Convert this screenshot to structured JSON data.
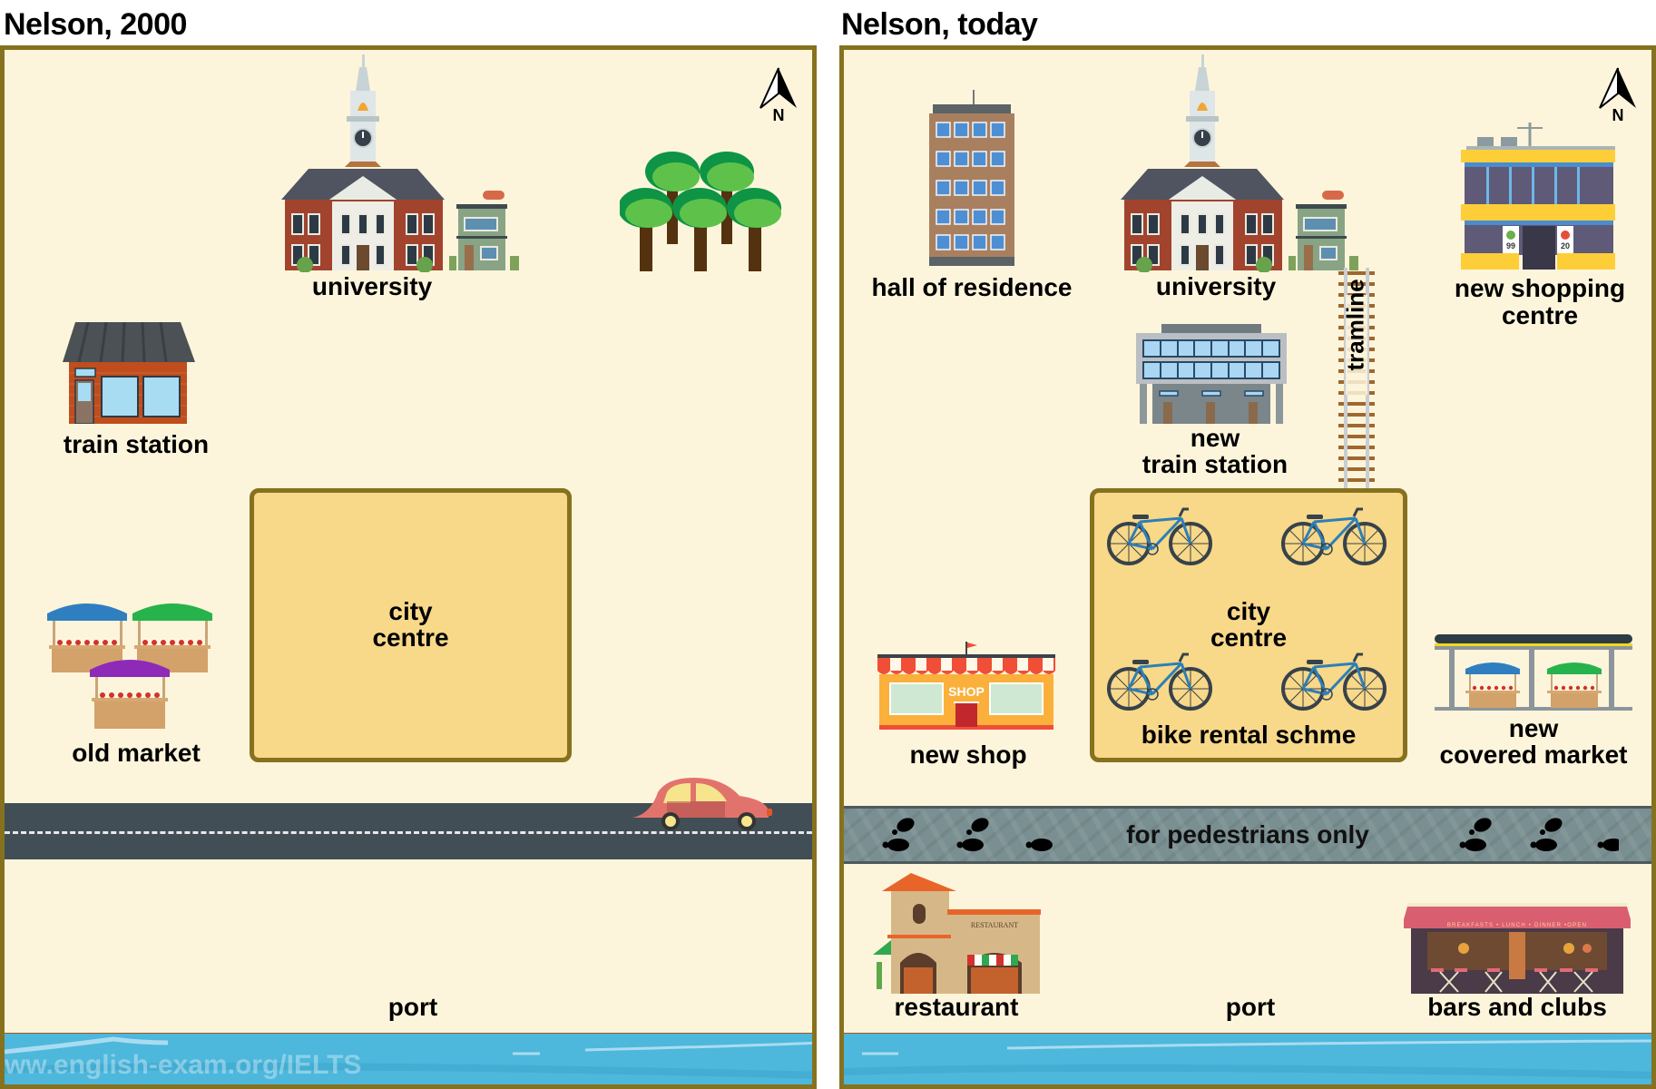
{
  "left_map": {
    "title": "Nelson, 2000",
    "compass_letter": "N",
    "labels": {
      "university": "university",
      "train_station": "train station",
      "city_centre_line1": "city",
      "city_centre_line2": "centre",
      "old_market": "old market",
      "port": "port"
    },
    "features": [
      "university",
      "trees",
      "train station",
      "city centre",
      "old market",
      "road with car",
      "port",
      "sea"
    ],
    "watermark": "ww.english-exam.org/IELTS"
  },
  "right_map": {
    "title": "Nelson, today",
    "compass_letter": "N",
    "labels": {
      "hall_of_residence": "hall of residence",
      "university": "university",
      "new_shopping_centre_line1": "new shopping",
      "new_shopping_centre_line2": "centre",
      "tramline": "tramline",
      "new_train_station_line1": "new",
      "new_train_station_line2": "train station",
      "city_centre_line1": "city",
      "city_centre_line2": "centre",
      "bike_rental": "bike rental schme",
      "new_shop": "new shop",
      "new_covered_market_line1": "new",
      "new_covered_market_line2": "covered market",
      "pedestrian_zone": "for pedestrians only",
      "restaurant": "restaurant",
      "port": "port",
      "bars_and_clubs": "bars and clubs"
    },
    "icon_signs": {
      "shop_sign": "SHOP",
      "restaurant_sign": "RESTAURANT",
      "bar_awning": "BREAKFASTS • LUNCH • DINNER •OPEN",
      "shopping_price_1": "99",
      "shopping_price_2": "20"
    },
    "bike_count": 4
  },
  "colors": {
    "frame": "#86721e",
    "land": "#fdf5db",
    "city_centre": "#f8d889",
    "road": "#414e56",
    "water": "#4db7dc",
    "quay": "#a4551f",
    "pedestrian": "#7a8f91"
  }
}
